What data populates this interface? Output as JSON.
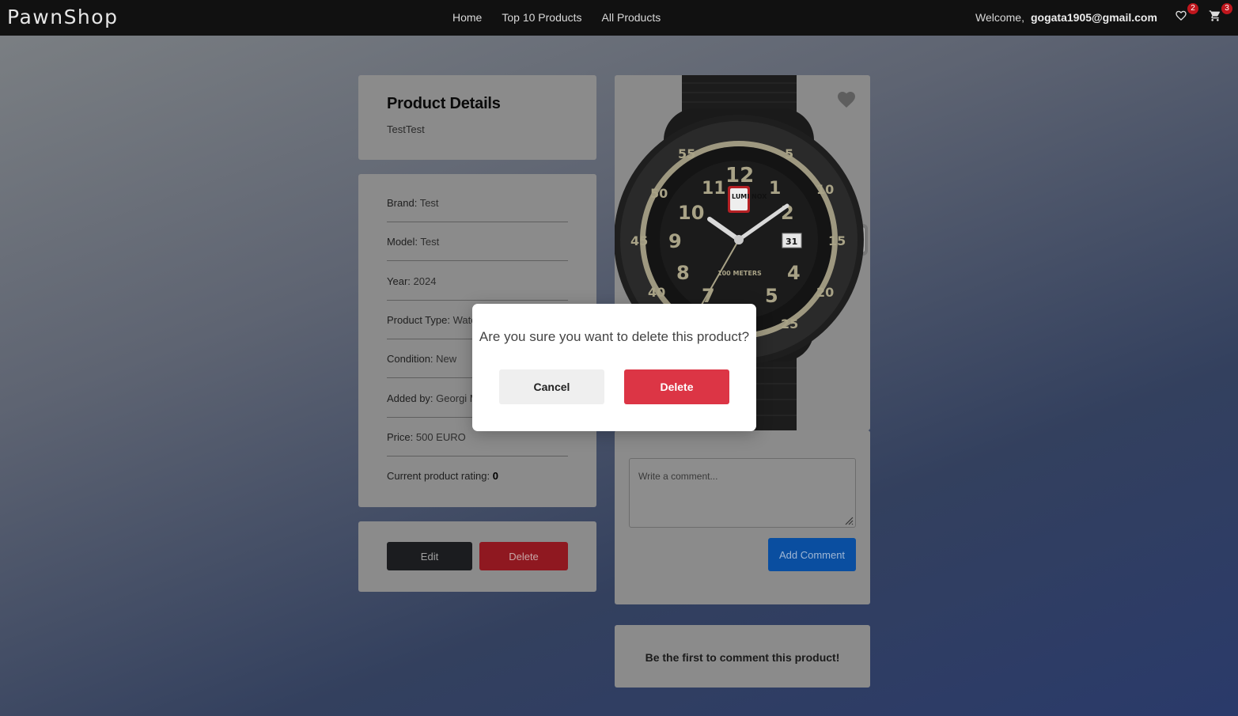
{
  "navbar": {
    "brand": "PawnShop",
    "links": [
      "Home",
      "Top 10 Products",
      "All Products"
    ],
    "welcome_label": "Welcome,",
    "user_email": "gogata1905@gmail.com",
    "wishlist_count": "2",
    "cart_count": "3"
  },
  "product": {
    "heading": "Product Details",
    "name": "TestTest",
    "details": [
      {
        "label": "Brand:",
        "value": "Test"
      },
      {
        "label": "Model:",
        "value": "Test"
      },
      {
        "label": "Year:",
        "value": "2024"
      },
      {
        "label": "Product Type:",
        "value": "Watch"
      },
      {
        "label": "Condition:",
        "value": "New"
      },
      {
        "label": "Added by:",
        "value": "Georgi Mar"
      },
      {
        "label": "Price:",
        "value": "500 EURO"
      },
      {
        "label": "Current product rating:",
        "value": "0"
      }
    ],
    "edit_label": "Edit",
    "delete_label": "Delete"
  },
  "comments": {
    "placeholder": "Write a comment...",
    "add_label": "Add Comment",
    "empty_message": "Be the first to comment this product!"
  },
  "modal": {
    "question": "Are you sure you want to delete this product?",
    "cancel_label": "Cancel",
    "delete_label": "Delete"
  },
  "watch_image": {
    "brand_text": "LUMI NOX",
    "dial_text": "100 METERS",
    "date": "31"
  },
  "colors": {
    "navbar_bg": "#111111",
    "danger": "#dc3545",
    "primary": "#0a4ea0",
    "badge": "#c0161d"
  },
  "icons": {
    "wishlist": "heart-outline-icon",
    "cart": "cart-icon",
    "favorite": "heart-icon",
    "resize": "resize-handle-icon"
  }
}
